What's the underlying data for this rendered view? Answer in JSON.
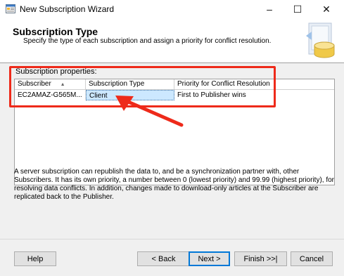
{
  "window": {
    "title": "New Subscription Wizard",
    "minimize": "–",
    "maximize": "☐",
    "close": "✕"
  },
  "header": {
    "title": "Subscription Type",
    "subtitle": "Specify the type of each subscription and assign a priority for conflict resolution."
  },
  "properties": {
    "label": "Subscription properties:",
    "columns": [
      "Subscriber",
      "Subscription Type",
      "Priority for Conflict Resolution"
    ],
    "sort_indicator": "▲",
    "rows": [
      {
        "subscriber": "EC2AMAZ-G565M...",
        "type": "Client",
        "priority": "First to Publisher wins"
      }
    ]
  },
  "description": "A server subscription can republish the data to, and be a synchronization partner with, other Subscribers. It has its own priority, a number between 0 (lowest priority) and 99.99 (highest priority), for resolving data conflicts. In addition, changes made to download-only articles at the Subscriber are replicated back to the Publisher.",
  "buttons": {
    "help": "Help",
    "back": "< Back",
    "next": "Next >",
    "finish": "Finish >>|",
    "cancel": "Cancel"
  },
  "colors": {
    "annotation": "#ee2a1a",
    "selection": "#cce8ff"
  }
}
